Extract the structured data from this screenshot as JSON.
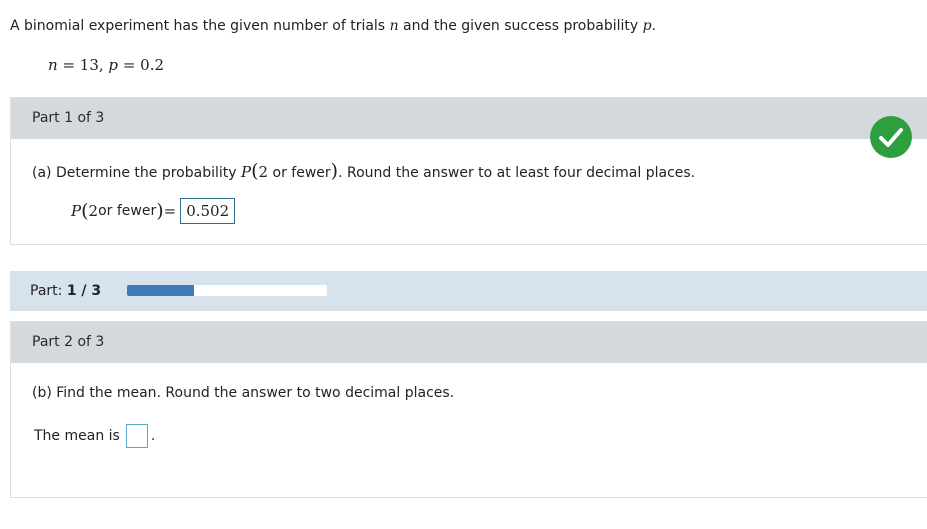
{
  "intro": {
    "text_before_n": "A binomial experiment has the given number of trials ",
    "n_symbol": "n",
    "text_middle": " and the given success probability ",
    "p_symbol": "p",
    "text_end": "."
  },
  "given": {
    "n_label": "n",
    "n_value": "= 13, ",
    "p_label": "p",
    "p_value": "= 0.2"
  },
  "part1": {
    "header": "Part 1 of 3",
    "question_prefix": "(a) Determine the probability ",
    "question_P": "P",
    "question_open": "(",
    "question_num": "2",
    "question_inner": " or fewer",
    "question_close": ")",
    "question_suffix": ". Round the answer to at least four decimal places.",
    "answer_P": "P",
    "answer_open": "(",
    "answer_num": "2",
    "answer_inner": " or fewer",
    "answer_close": ")",
    "answer_equals": " =",
    "answer_value": "0.502",
    "status": "correct",
    "status_color": "#2e9e3e"
  },
  "progress": {
    "label_prefix": "Part: ",
    "label_value": "1 / 3",
    "fraction": 0.3333,
    "fill_color": "#3e7cb8"
  },
  "part2": {
    "header": "Part 2 of 3",
    "question": "(b) Find the mean. Round the answer to two decimal places.",
    "mean_label": "The mean is",
    "mean_value": "",
    "mean_suffix": "."
  }
}
